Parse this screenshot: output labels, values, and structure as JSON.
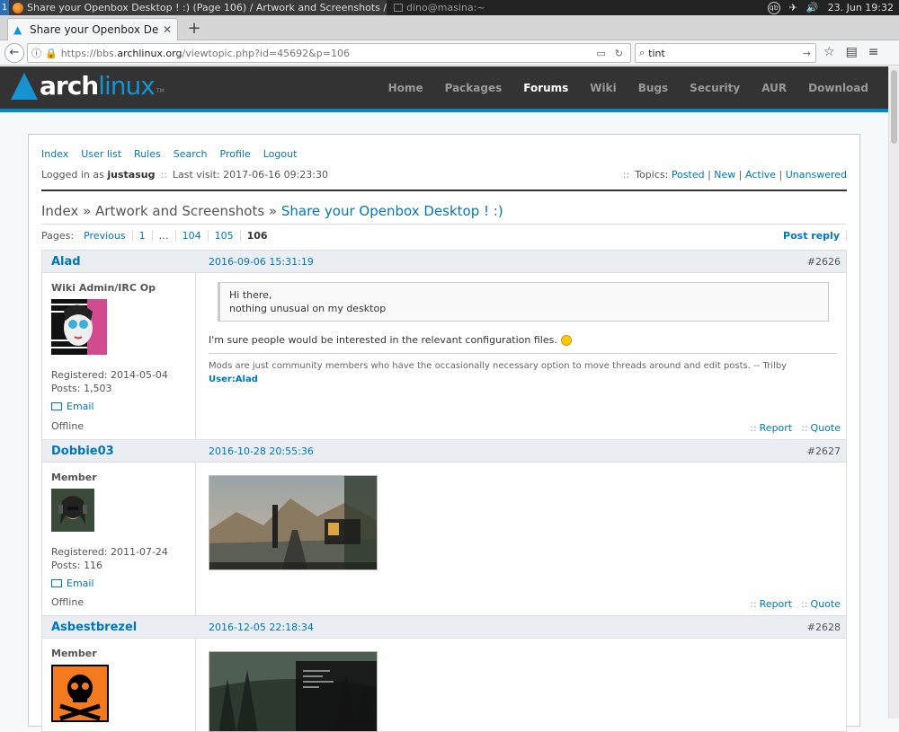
{
  "wm": {
    "workspace": "1",
    "active_window_title": "Share your Openbox Desktop ! :) (Page 106) / Artwork and Screenshots / Arc…",
    "terminal_title": "dino@masina:~",
    "tray_qb": "qb",
    "clock": "23. Jun 19:32"
  },
  "browser": {
    "tab_title": "Share your Openbox De",
    "url_prefix": "https://bbs.",
    "url_domain": "archlinux.org",
    "url_path": "/viewtopic.php?id=45692&p=106",
    "search_value": "tint"
  },
  "site": {
    "logo_part1": "arch",
    "logo_part2": "linux",
    "logo_tm": "TM",
    "nav": [
      "Home",
      "Packages",
      "Forums",
      "Wiki",
      "Bugs",
      "Security",
      "AUR",
      "Download"
    ]
  },
  "forum": {
    "menu": [
      "Index",
      "User list",
      "Rules",
      "Search",
      "Profile",
      "Logout"
    ],
    "logged_in_label": "Logged in as",
    "username": "justasug",
    "last_visit": "Last visit: 2017-06-16 09:23:30",
    "topics_label": "Topics:",
    "topic_links": [
      "Posted",
      "New",
      "Active",
      "Unanswered"
    ],
    "crumbs": [
      "Index",
      "Artwork and Screenshots",
      "Share your Openbox Desktop ! :)"
    ],
    "pages_label": "Pages:",
    "pages": [
      "Previous",
      "1",
      "…",
      "104",
      "105"
    ],
    "current_page": "106",
    "post_reply": "Post reply"
  },
  "posts": [
    {
      "author": "Alad",
      "date": "2016-09-06 15:31:19",
      "num": "#2626",
      "title": "Wiki Admin/IRC Op",
      "registered": "Registered: 2014-05-04",
      "posts": "Posts: 1,503",
      "email": "Email",
      "status": "Offline",
      "quote_line1": "Hi there,",
      "quote_line2": "nothing unusual on my desktop",
      "message": "I'm sure people would be interested in the relevant configuration files.",
      "signature": "Mods are just community members who have the occasionally necessary option to move threads around and edit posts. -- Trilby",
      "sig_link": "User:Alad",
      "report": "Report",
      "quote_btn": "Quote"
    },
    {
      "author": "Dobbie03",
      "date": "2016-10-28 20:55:36",
      "num": "#2627",
      "title": "Member",
      "registered": "Registered: 2011-07-24",
      "posts": "Posts: 116",
      "email": "Email",
      "status": "Offline",
      "report": "Report",
      "quote_btn": "Quote"
    },
    {
      "author": "Asbestbrezel",
      "date": "2016-12-05 22:18:34",
      "num": "#2628",
      "title": "Member"
    }
  ]
}
